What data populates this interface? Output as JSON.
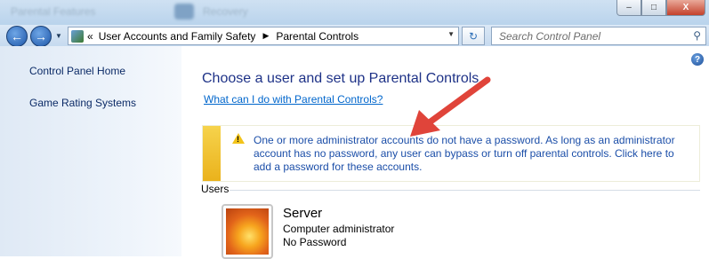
{
  "window": {
    "background_tabs": [
      "Parental Features",
      "Recovery"
    ],
    "controls": {
      "minimize": "–",
      "maximize": "□",
      "close": "X"
    }
  },
  "nav": {
    "back_icon": "arrow-left-icon",
    "forward_icon": "arrow-right-icon",
    "breadcrumb_prefix": "«",
    "breadcrumb": [
      "User Accounts and Family Safety",
      "Parental Controls"
    ],
    "search_placeholder": "Search Control Panel"
  },
  "sidebar": {
    "items": [
      {
        "label": "Control Panel Home"
      },
      {
        "label": "Game Rating Systems"
      }
    ]
  },
  "main": {
    "title": "Choose a user and set up Parental Controls",
    "help_link": "What can I do with Parental Controls?",
    "warning": "One or more administrator accounts do not have a password. As long as an administrator account has no password, any user can bypass or turn off parental controls. Click here to add a password for these accounts.",
    "users_header": "Users",
    "users": [
      {
        "name": "Server",
        "role": "Computer administrator",
        "password_status": "No Password"
      }
    ]
  },
  "colors": {
    "heading": "#1e3287",
    "link": "#0066cc",
    "warning_bar": "#f2c31a",
    "annotation_arrow": "#e0443a"
  }
}
